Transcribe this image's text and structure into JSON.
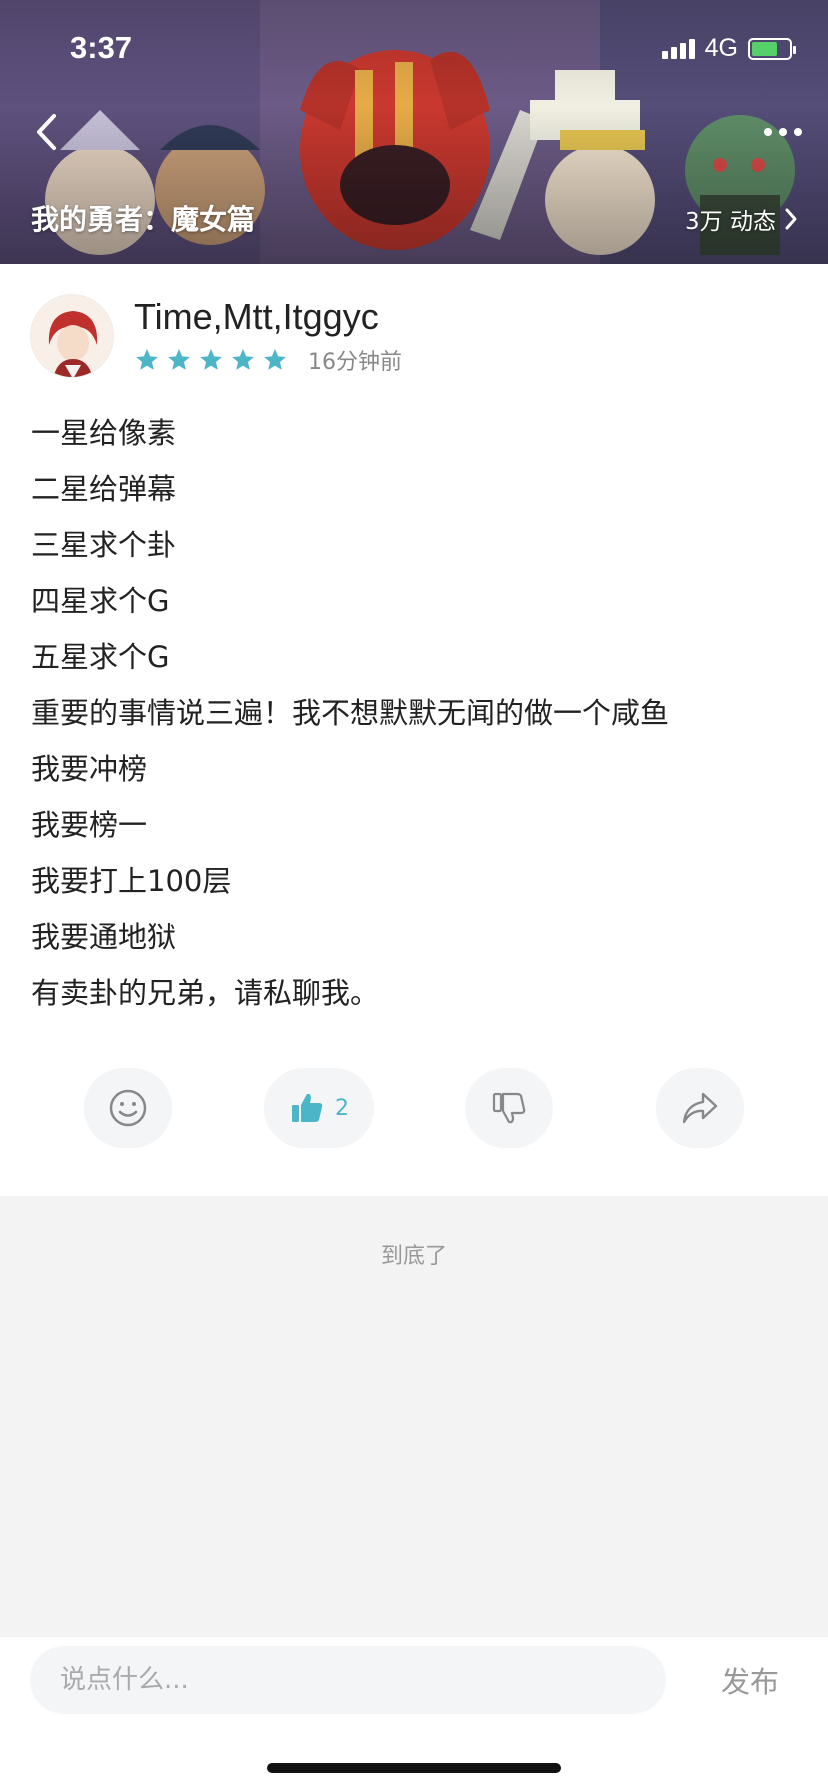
{
  "status": {
    "time": "3:37",
    "network": "4G"
  },
  "header": {
    "game_title": "我的勇者：魔女篇",
    "moments": "3万 动态"
  },
  "post": {
    "author": "Time,Mtt,Itggyc",
    "rating": 5,
    "time_ago": "16分钟前",
    "lines": [
      "一星给像素",
      "二星给弹幕",
      "三星求个卦",
      "四星求个G",
      "五星求个G",
      "重要的事情说三遍！我不想默默无闻的做一个咸鱼",
      "我要冲榜",
      "我要榜一",
      "我要打上100层",
      "我要通地狱",
      "有卖卦的兄弟，请私聊我。"
    ]
  },
  "actions": {
    "like_count": "2"
  },
  "footer": {
    "end_text": "到底了",
    "comment_placeholder": "说点什么...",
    "publish_label": "发布"
  },
  "colors": {
    "accent": "#4cb6c8",
    "star": "#4cb6c8",
    "battery": "#56d16a"
  }
}
